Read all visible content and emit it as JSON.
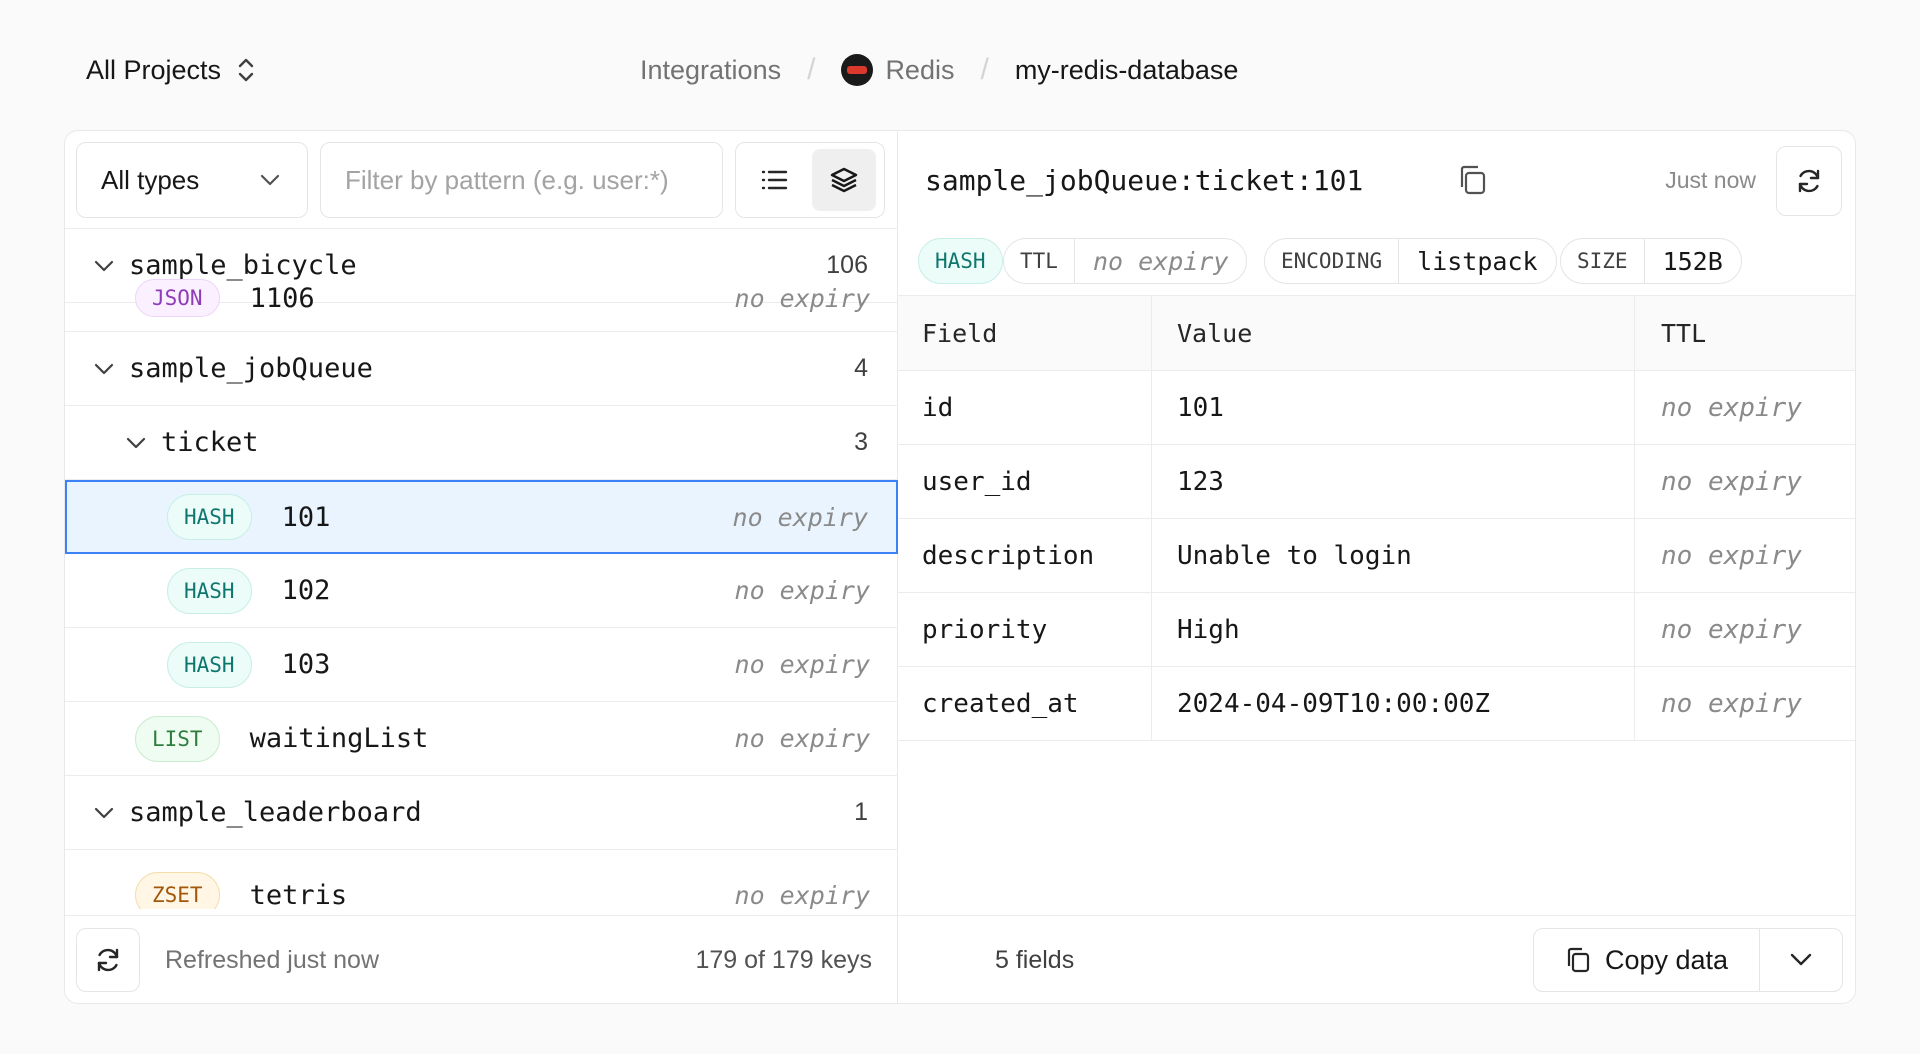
{
  "header": {
    "project_switcher": "All Projects",
    "breadcrumb": {
      "integrations": "Integrations",
      "provider": "Redis",
      "database": "my-redis-database"
    }
  },
  "browser": {
    "type_filter": "All types",
    "pattern_placeholder": "Filter by pattern (e.g. user:*)",
    "rows": [
      {
        "kind": "group",
        "name": "sample_bicycle",
        "count": "106"
      },
      {
        "kind": "key",
        "type": "JSON",
        "name": "1106",
        "ttl": "no expiry"
      },
      {
        "kind": "group",
        "name": "sample_jobQueue",
        "count": "4"
      },
      {
        "kind": "group",
        "name": "ticket",
        "count": "3"
      },
      {
        "kind": "key",
        "type": "HASH",
        "name": "101",
        "ttl": "no expiry"
      },
      {
        "kind": "key",
        "type": "HASH",
        "name": "102",
        "ttl": "no expiry"
      },
      {
        "kind": "key",
        "type": "HASH",
        "name": "103",
        "ttl": "no expiry"
      },
      {
        "kind": "key",
        "type": "LIST",
        "name": "waitingList",
        "ttl": "no expiry"
      },
      {
        "kind": "group",
        "name": "sample_leaderboard",
        "count": "1"
      },
      {
        "kind": "key",
        "type": "ZSET",
        "name": "tetris",
        "ttl": "no expiry"
      }
    ],
    "footer": {
      "refreshed": "Refreshed just now",
      "key_count": "179 of 179 keys"
    }
  },
  "detail": {
    "key_name": "sample_jobQueue:ticket:101",
    "updated": "Just now",
    "meta": {
      "type": "HASH",
      "ttl_label": "TTL",
      "ttl_value": "no expiry",
      "encoding_label": "ENCODING",
      "encoding_value": "listpack",
      "size_label": "SIZE",
      "size_value": "152B"
    },
    "table": {
      "columns": [
        "Field",
        "Value",
        "TTL"
      ],
      "rows": [
        [
          "id",
          "101",
          "no expiry"
        ],
        [
          "user_id",
          "123",
          "no expiry"
        ],
        [
          "description",
          "Unable to login",
          "no expiry"
        ],
        [
          "priority",
          "High",
          "no expiry"
        ],
        [
          "created_at",
          "2024-04-09T10:00:00Z",
          "no expiry"
        ]
      ]
    },
    "footer": {
      "field_count": "5 fields",
      "copy_label": "Copy data"
    }
  }
}
